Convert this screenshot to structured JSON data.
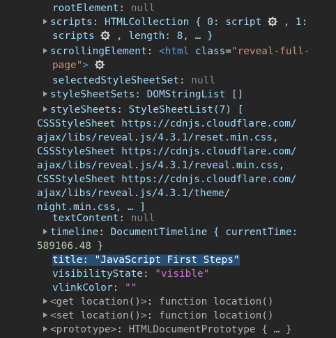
{
  "props": {
    "rootElement": {
      "key": "rootElement",
      "sep": ": ",
      "value": "null"
    },
    "scripts": {
      "key": "scripts",
      "sep": ": ",
      "type": "HTMLCollection { 0: script",
      "mid": " , 1:",
      "line2a": "scripts",
      "line2b": " , length: 8, … }"
    },
    "scrollingElement": {
      "key": "scrollingElement",
      "sep": ": ",
      "open": "<html ",
      "attr": "class",
      "eq": "=",
      "val1": "\"reveal-full-",
      "val2": "page\"",
      "close": ">"
    },
    "selectedStyleSheetSet": {
      "key": "selectedStyleSheetSet",
      "sep": ": ",
      "value": "null"
    },
    "styleSheetSets": {
      "key": "styleSheetSets",
      "sep": ": ",
      "value": "DOMStringList []"
    },
    "styleSheets": {
      "key": "styleSheets",
      "sep": ": ",
      "value": "StyleSheetList(7) [",
      "lines": [
        "CSSStyleSheet https://cdnjs.cloudflare.com/",
        "ajax/libs/reveal.js/4.3.1/reset.min.css,",
        "CSSStyleSheet https://cdnjs.cloudflare.com/",
        "ajax/libs/reveal.js/4.3.1/reveal.min.css,",
        "CSSStyleSheet https://cdnjs.cloudflare.com/",
        "ajax/libs/reveal.js/4.3.1/theme/",
        "night.min.css, … ]"
      ]
    },
    "textContent": {
      "key": "textContent",
      "sep": ": ",
      "value": "null"
    },
    "timeline": {
      "key": "timeline",
      "sep": ": ",
      "value": "DocumentTimeline { currentTime:",
      "number": "589106.48",
      "close": " }"
    },
    "title": {
      "text": "title: \"JavaScript First Steps\""
    },
    "visibilityState": {
      "key": "visibilityState",
      "sep": ": ",
      "value": "\"visible\""
    },
    "vlinkColor": {
      "key": "vlinkColor",
      "sep": ": ",
      "value": "\"\""
    },
    "getLocation": {
      "key": "<get location()>",
      "sep": ": ",
      "value": "function location()"
    },
    "setLocation": {
      "key": "<set location()>",
      "sep": ": ",
      "value": "function location()"
    },
    "prototype": {
      "key": "<prototype>",
      "sep": ": ",
      "value": "HTMLDocumentPrototype { … }"
    }
  },
  "icons": {
    "expand": "triangle-right-icon",
    "inspect": "gear-icon"
  },
  "colors": {
    "background": "#252526",
    "key": "#9cdcfe",
    "string": "#ce9178",
    "number": "#b5cea8",
    "selection": "#264f78"
  }
}
